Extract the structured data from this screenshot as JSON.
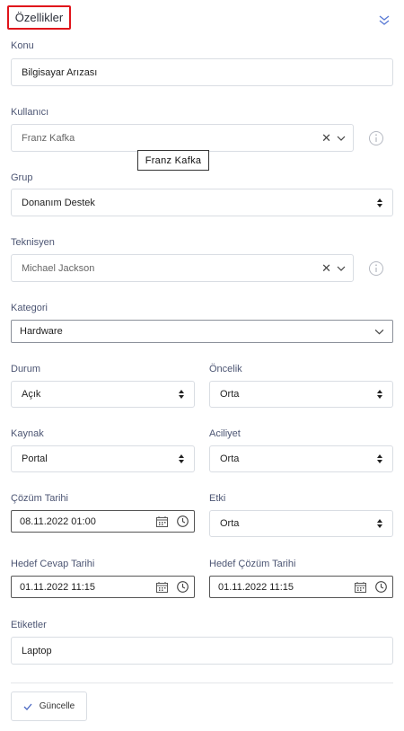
{
  "header": {
    "title": "Özellikler"
  },
  "fields": {
    "konu": {
      "label": "Konu",
      "value": "Bilgisayar Arızası"
    },
    "kullanici": {
      "label": "Kullanıcı",
      "value": "Franz Kafka",
      "tooltip": "Franz  Kafka"
    },
    "grup": {
      "label": "Grup",
      "value": "Donanım Destek"
    },
    "teknisyen": {
      "label": "Teknisyen",
      "value": "Michael Jackson"
    },
    "kategori": {
      "label": "Kategori",
      "value": "Hardware"
    },
    "durum": {
      "label": "Durum",
      "value": "Açık"
    },
    "oncelik": {
      "label": "Öncelik",
      "value": "Orta"
    },
    "kaynak": {
      "label": "Kaynak",
      "value": "Portal"
    },
    "aciliyet": {
      "label": "Aciliyet",
      "value": "Orta"
    },
    "cozum_tarihi": {
      "label": "Çözüm Tarihi",
      "value": "08.11.2022 01:00"
    },
    "etki": {
      "label": "Etki",
      "value": "Orta"
    },
    "hedef_cevap_tarihi": {
      "label": "Hedef Cevap Tarihi",
      "value": "01.11.2022 11:15"
    },
    "hedef_cozum_tarihi": {
      "label": "Hedef Çözüm Tarihi",
      "value": "01.11.2022 11:15"
    },
    "etiketler": {
      "label": "Etiketler",
      "value": "Laptop"
    }
  },
  "actions": {
    "update_label": "Güncelle"
  },
  "colors": {
    "highlight_border": "#e0141b",
    "label_text": "#4c5573",
    "border": "#d9dde3",
    "accent": "#5b7bd5"
  }
}
